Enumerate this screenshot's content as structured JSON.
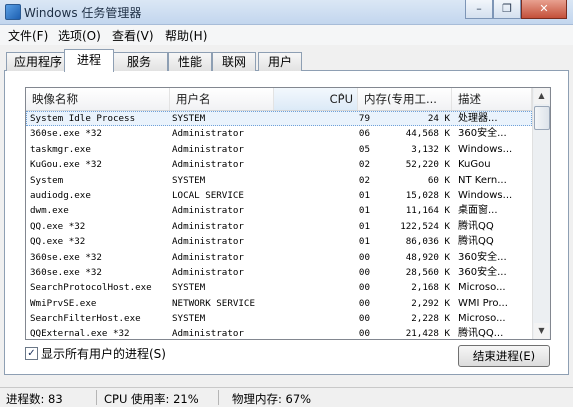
{
  "window": {
    "title": "Windows 任务管理器",
    "minimize_glyph": "–",
    "restore_glyph": "❐",
    "close_glyph": "✕"
  },
  "menu": [
    "文件(F)",
    "选项(O)",
    "查看(V)",
    "帮助(H)"
  ],
  "tabs": [
    "应用程序",
    "进程",
    "服务",
    "性能",
    "联网",
    "用户"
  ],
  "active_tab": "进程",
  "table": {
    "headers": {
      "name": "映像名称",
      "user": "用户名",
      "cpu": "CPU",
      "mem": "内存(专用工...",
      "desc": "描述"
    },
    "sort_glyph": "^",
    "rows": [
      {
        "name": "System Idle Process",
        "user": "SYSTEM",
        "cpu": "79",
        "mem": "24 K",
        "desc": "处理器..."
      },
      {
        "name": "360se.exe *32",
        "user": "Administrator",
        "cpu": "06",
        "mem": "44,568 K",
        "desc": "360安全..."
      },
      {
        "name": "taskmgr.exe",
        "user": "Administrator",
        "cpu": "05",
        "mem": "3,132 K",
        "desc": "Windows..."
      },
      {
        "name": "KuGou.exe *32",
        "user": "Administrator",
        "cpu": "02",
        "mem": "52,220 K",
        "desc": "KuGou"
      },
      {
        "name": "System",
        "user": "SYSTEM",
        "cpu": "02",
        "mem": "60 K",
        "desc": "NT Kern..."
      },
      {
        "name": "audiodg.exe",
        "user": "LOCAL SERVICE",
        "cpu": "01",
        "mem": "15,028 K",
        "desc": "Windows..."
      },
      {
        "name": "dwm.exe",
        "user": "Administrator",
        "cpu": "01",
        "mem": "11,164 K",
        "desc": "桌面窗..."
      },
      {
        "name": "QQ.exe *32",
        "user": "Administrator",
        "cpu": "01",
        "mem": "122,524 K",
        "desc": "腾讯QQ"
      },
      {
        "name": "QQ.exe *32",
        "user": "Administrator",
        "cpu": "01",
        "mem": "86,036 K",
        "desc": "腾讯QQ"
      },
      {
        "name": "360se.exe *32",
        "user": "Administrator",
        "cpu": "00",
        "mem": "48,920 K",
        "desc": "360安全..."
      },
      {
        "name": "360se.exe *32",
        "user": "Administrator",
        "cpu": "00",
        "mem": "28,560 K",
        "desc": "360安全..."
      },
      {
        "name": "SearchProtocolHost.exe",
        "user": "SYSTEM",
        "cpu": "00",
        "mem": "2,168 K",
        "desc": "Microso..."
      },
      {
        "name": "WmiPrvSE.exe",
        "user": "NETWORK SERVICE",
        "cpu": "00",
        "mem": "2,292 K",
        "desc": "WMI Pro..."
      },
      {
        "name": "SearchFilterHost.exe",
        "user": "SYSTEM",
        "cpu": "00",
        "mem": "2,228 K",
        "desc": "Microso..."
      },
      {
        "name": "QQExternal.exe *32",
        "user": "Administrator",
        "cpu": "00",
        "mem": "21,428 K",
        "desc": "腾讯QQ..."
      }
    ]
  },
  "scroll": {
    "up_glyph": "▲",
    "down_glyph": "▼"
  },
  "show_all_users": {
    "label": "显示所有用户的进程(S)",
    "checked": true,
    "check_glyph": "✓"
  },
  "end_process_label": "结束进程(E)",
  "status": {
    "processes": "进程数: 83",
    "cpu": "CPU 使用率: 21%",
    "memory": "物理内存: 67%"
  }
}
